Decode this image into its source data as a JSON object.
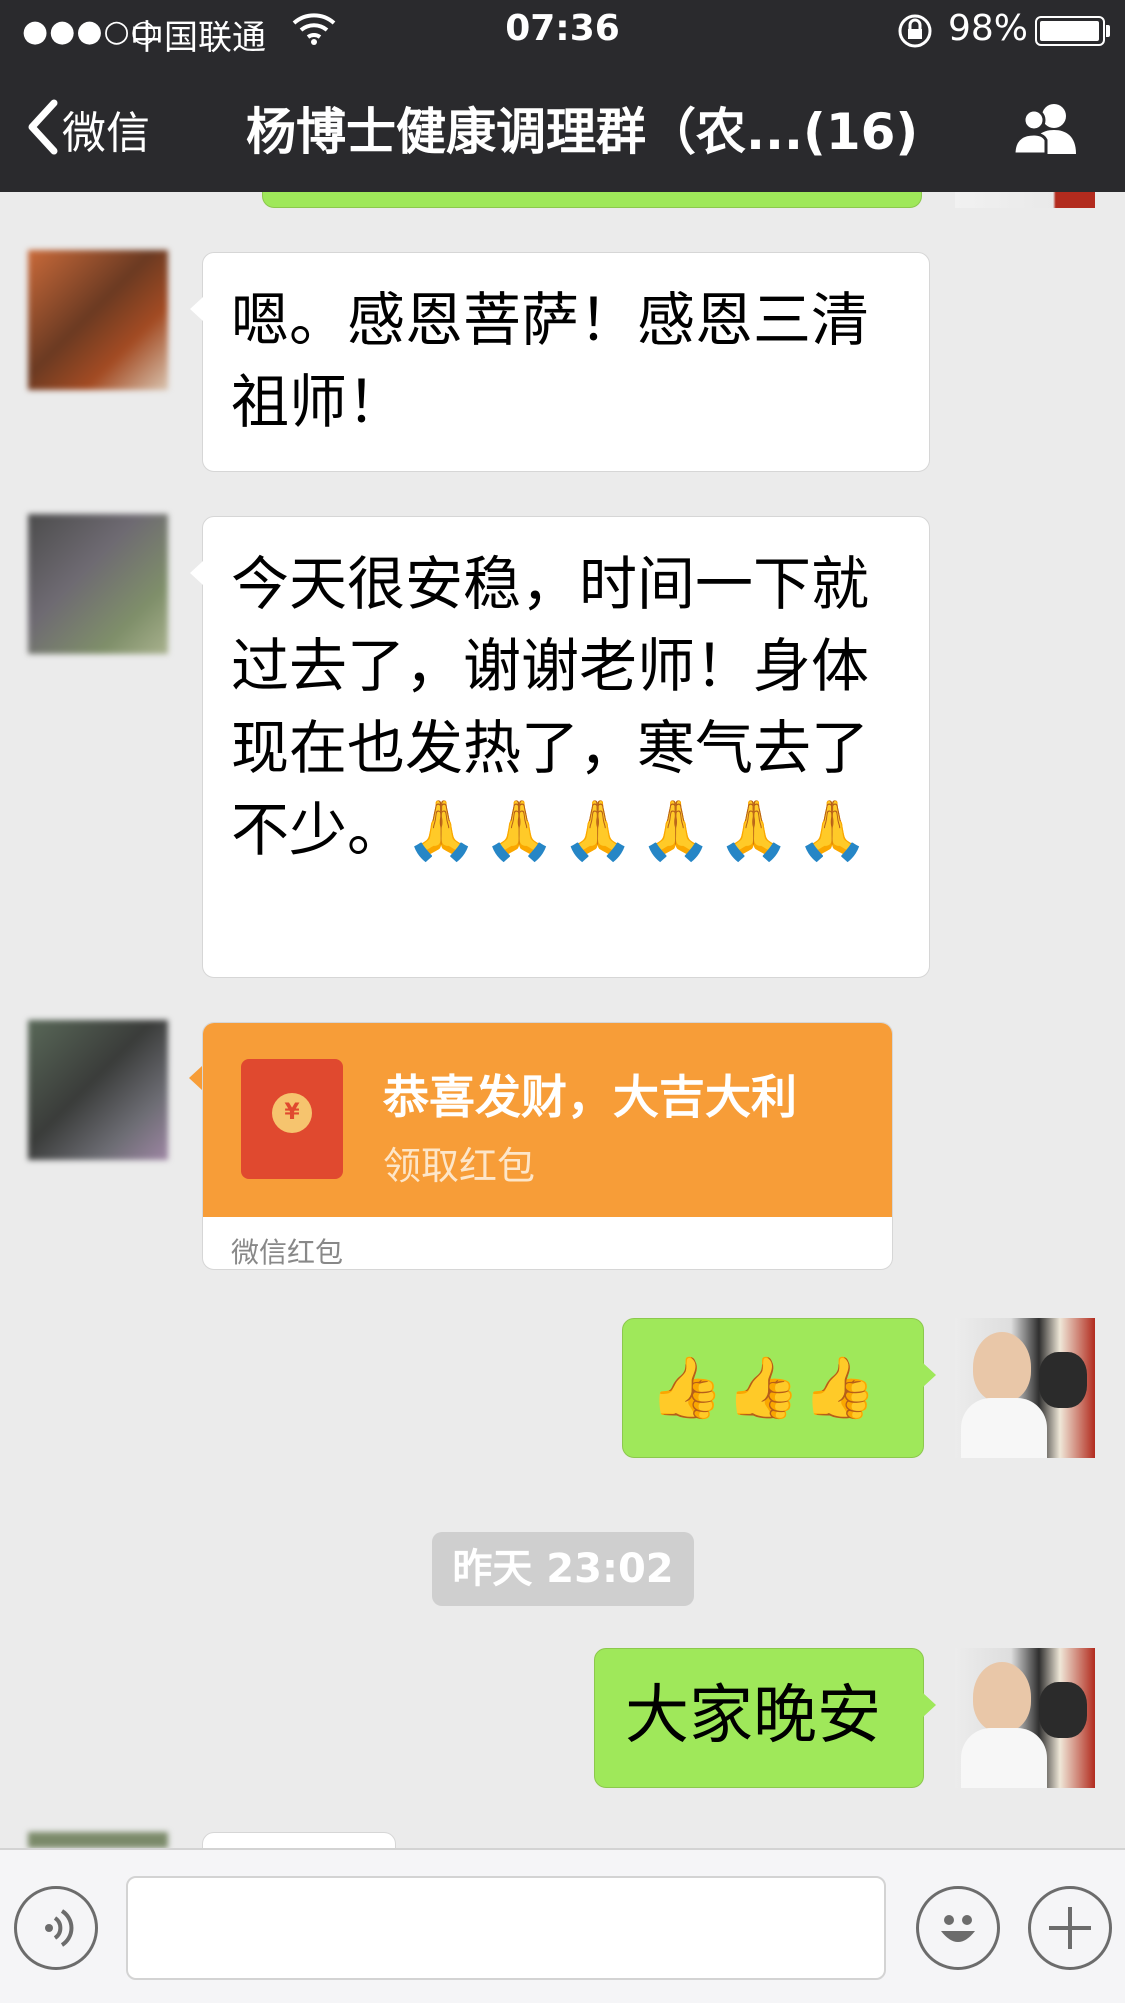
{
  "status_bar": {
    "signal": "●●●○○",
    "carrier": "中国联通",
    "time": "07:36",
    "battery_percent": "98%",
    "battery_level": 0.98
  },
  "nav": {
    "back_label": "微信",
    "title": "杨博士健康调理群（农...(16)"
  },
  "messages": [
    {
      "side": "in",
      "text": "嗯。感恩菩萨！感恩三清祖师！"
    },
    {
      "side": "in",
      "text": "今天很安稳，时间一下就过去了，谢谢老师！身体现在也发热了，寒气去了不少。",
      "emoji": "🙏🙏🙏🙏🙏🙏"
    },
    {
      "side": "in",
      "type": "red_packet",
      "title": "恭喜发财，大吉大利",
      "subtitle": "领取红包",
      "footer": "微信红包"
    },
    {
      "side": "out",
      "emoji": "👍👍👍"
    },
    {
      "type": "timestamp",
      "text": "昨天 23:02"
    },
    {
      "side": "out",
      "text": "大家晚安"
    }
  ],
  "colors": {
    "header_bg": "#2a2a2d",
    "chat_bg": "#ebebeb",
    "outgoing_bubble": "#9fe85a",
    "red_packet": "#f79d38"
  },
  "icons": [
    "back-chevron-icon",
    "wifi-icon",
    "rotation-lock-icon",
    "battery-icon",
    "group-members-icon",
    "voice-icon",
    "emoji-icon",
    "plus-icon",
    "red-packet-icon"
  ]
}
